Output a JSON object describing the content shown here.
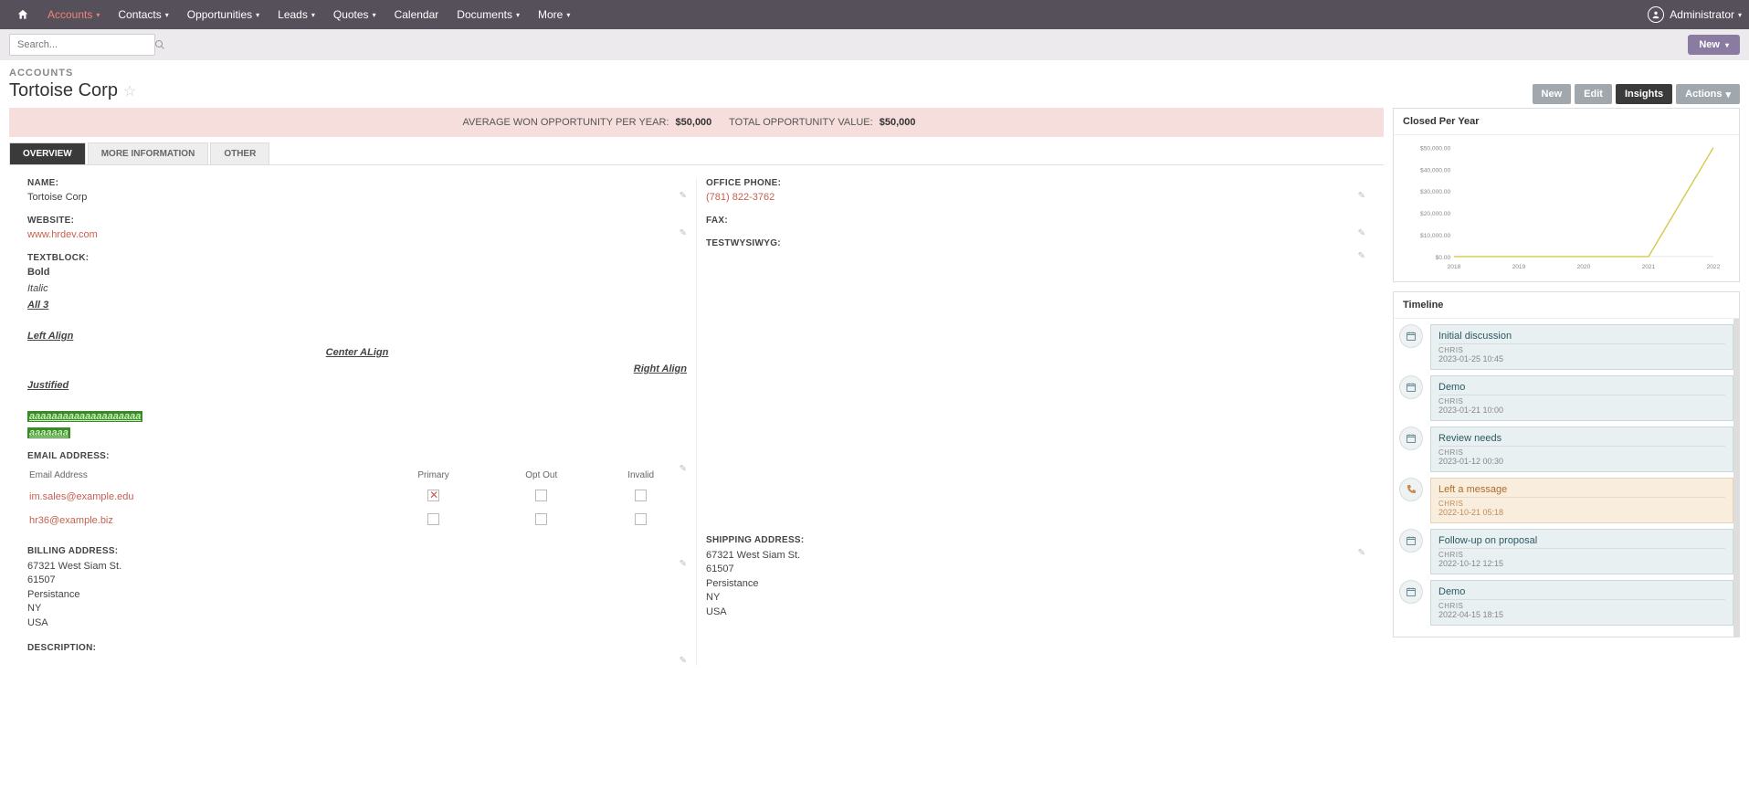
{
  "nav": {
    "items": [
      "Accounts",
      "Contacts",
      "Opportunities",
      "Leads",
      "Quotes",
      "Calendar",
      "Documents",
      "More"
    ],
    "active_index": 0,
    "user_label": "Administrator"
  },
  "search": {
    "placeholder": "Search..."
  },
  "subbar": {
    "new_label": "New"
  },
  "header": {
    "breadcrumb": "ACCOUNTS",
    "title": "Tortoise Corp",
    "buttons": {
      "new": "New",
      "edit": "Edit",
      "insights": "Insights",
      "actions": "Actions"
    }
  },
  "kpi": {
    "avg_label": "AVERAGE WON OPPORTUNITY PER YEAR:",
    "avg_value": "$50,000",
    "total_label": "TOTAL OPPORTUNITY VALUE:",
    "total_value": "$50,000"
  },
  "tabs": [
    "OVERVIEW",
    "MORE INFORMATION",
    "OTHER"
  ],
  "fields": {
    "name_label": "NAME:",
    "name_value": "Tortoise Corp",
    "website_label": "WEBSITE:",
    "website_value": "www.hrdev.com",
    "textblock_label": "TEXTBLOCK:",
    "tb": {
      "bold": "Bold",
      "italic": "Italic",
      "all3": "All 3",
      "left": "Left Align",
      "center": "Center ALign",
      "right": "Right Align",
      "just": "Justified",
      "hl1": "aaaaaaaaaaaaaaaaaaaa",
      "hl2": "aaaaaaa"
    },
    "email_label": "EMAIL ADDRESS:",
    "email_headers": {
      "addr": "Email Address",
      "primary": "Primary",
      "optout": "Opt Out",
      "invalid": "Invalid"
    },
    "emails": [
      {
        "addr": "im.sales@example.edu",
        "primary": true,
        "optout": false,
        "invalid": false
      },
      {
        "addr": "hr36@example.biz",
        "primary": false,
        "optout": false,
        "invalid": false
      }
    ],
    "billing_label": "BILLING ADDRESS:",
    "billing": {
      "l1": "67321 West Siam St.",
      "l2": "61507",
      "l3": "Persistance",
      "l4": "NY",
      "l5": "USA"
    },
    "description_label": "DESCRIPTION:",
    "office_phone_label": "OFFICE PHONE:",
    "office_phone_value": "(781) 822-3762",
    "fax_label": "FAX:",
    "testw_label": "TESTWYSIWYG:",
    "shipping_label": "SHIPPING ADDRESS:",
    "shipping": {
      "l1": "67321 West Siam St.",
      "l2": "61507",
      "l3": "Persistance",
      "l4": "NY",
      "l5": "USA"
    }
  },
  "chart": {
    "title": "Closed Per Year"
  },
  "chart_data": {
    "type": "line",
    "title": "Closed Per Year",
    "xlabel": "",
    "ylabel": "",
    "categories": [
      "2018",
      "2019",
      "2020",
      "2021",
      "2022"
    ],
    "values": [
      0,
      0,
      0,
      0,
      50000
    ],
    "ylim": [
      0,
      50000
    ],
    "yticks": [
      "$0.00",
      "$10,000.00",
      "$20,000.00",
      "$30,000.00",
      "$40,000.00",
      "$50,000.00"
    ]
  },
  "timeline": {
    "title": "Timeline",
    "items": [
      {
        "type": "meeting",
        "title": "Initial discussion",
        "who": "CHRIS",
        "ts": "2023-01-25 10:45"
      },
      {
        "type": "meeting",
        "title": "Demo",
        "who": "CHRIS",
        "ts": "2023-01-21 10:00"
      },
      {
        "type": "meeting",
        "title": "Review needs",
        "who": "CHRIS",
        "ts": "2023-01-12 00:30"
      },
      {
        "type": "phone",
        "title": "Left a message",
        "who": "CHRIS",
        "ts": "2022-10-21 05:18"
      },
      {
        "type": "meeting",
        "title": "Follow-up on proposal",
        "who": "CHRIS",
        "ts": "2022-10-12 12:15"
      },
      {
        "type": "meeting",
        "title": "Demo",
        "who": "CHRIS",
        "ts": "2022-04-15 18:15"
      }
    ]
  }
}
